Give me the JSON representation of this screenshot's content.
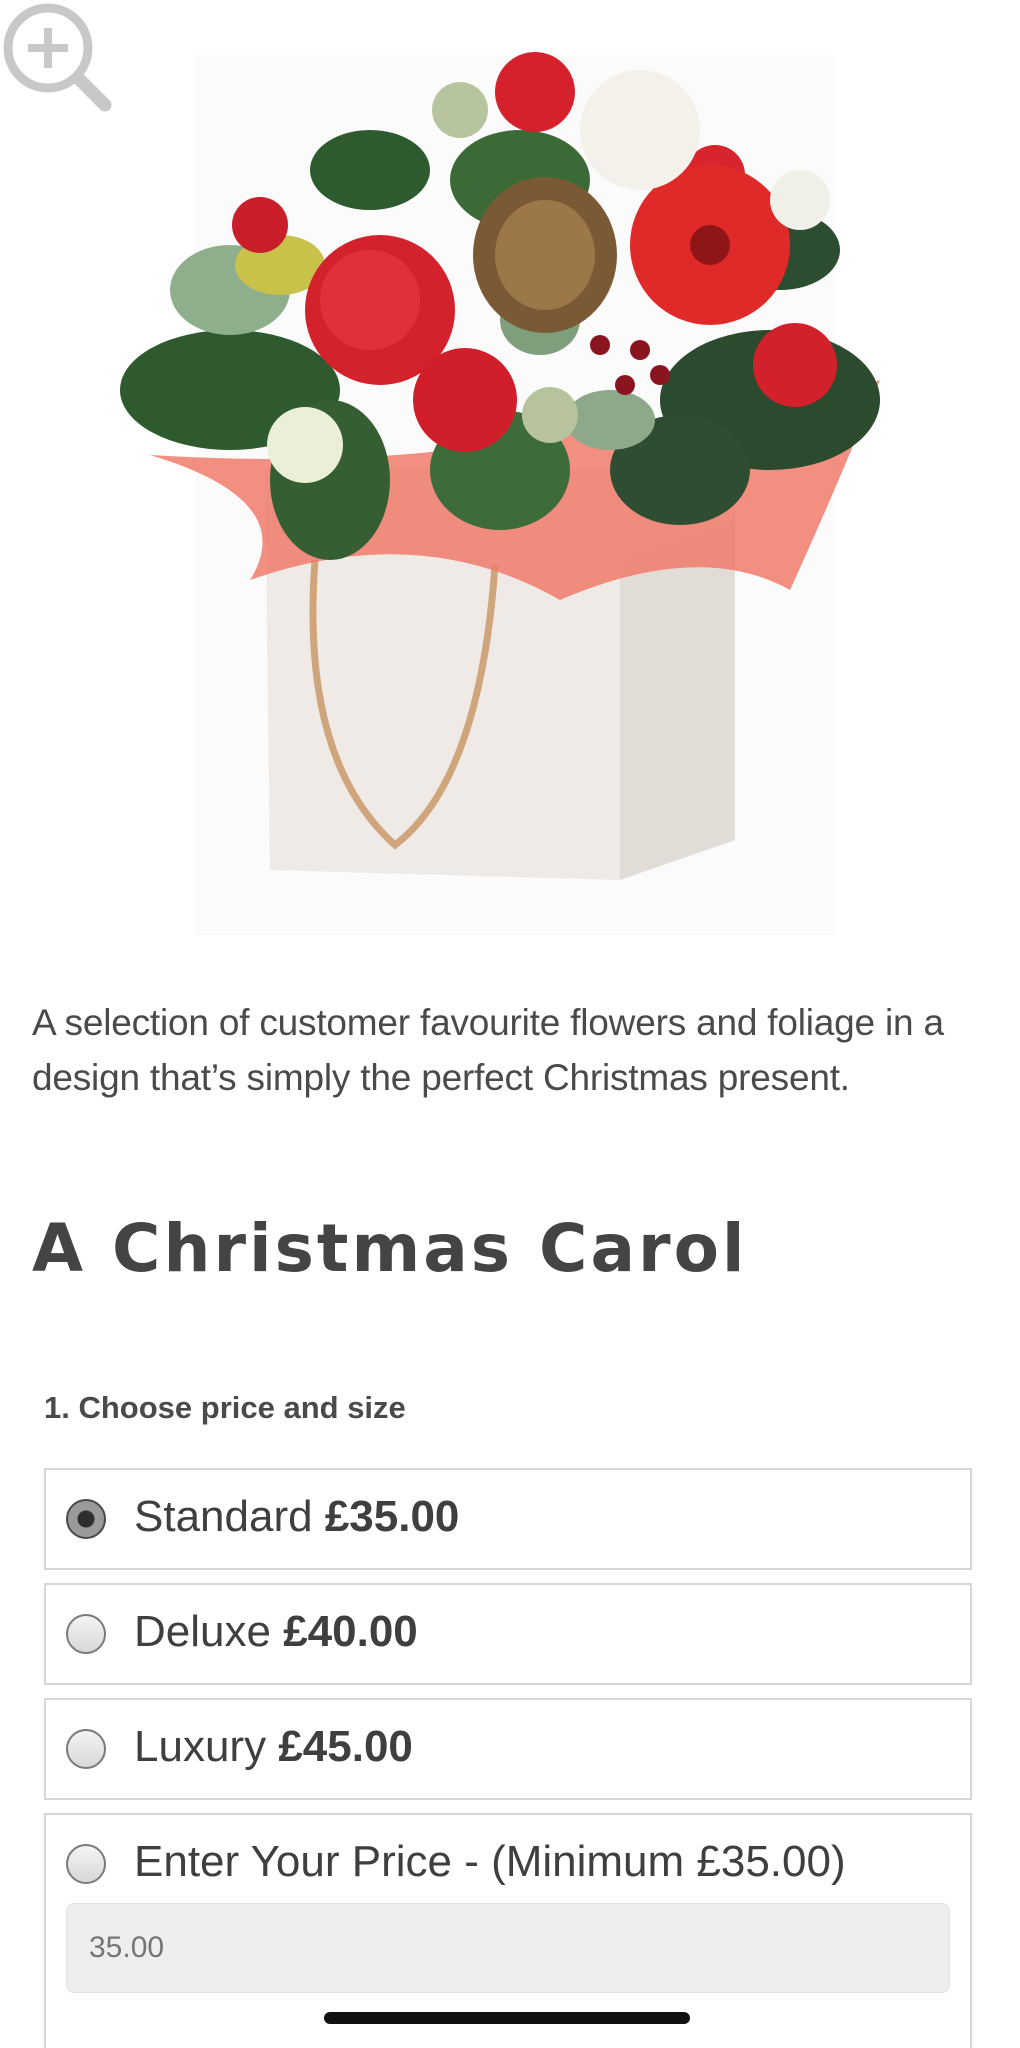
{
  "product": {
    "description": "A selection of customer favourite flowers and foliage in a design that’s simply the perfect Christmas present.",
    "title": "A Christmas Carol"
  },
  "options_section": {
    "label": "1. Choose price and size",
    "options": [
      {
        "name": "Standard",
        "price": "£35.00",
        "selected": true
      },
      {
        "name": "Deluxe",
        "price": "£40.00",
        "selected": false
      },
      {
        "name": "Luxury",
        "price": "£45.00",
        "selected": false
      }
    ],
    "custom": {
      "label": "Enter Your Price - (Minimum £35.00)",
      "placeholder": "35.00",
      "selected": false
    }
  },
  "icons": {
    "zoom": "zoom-in-icon"
  },
  "colors": {
    "text": "#3d3d3d",
    "border": "#d6d6d6",
    "input_bg": "#eeeeee"
  }
}
